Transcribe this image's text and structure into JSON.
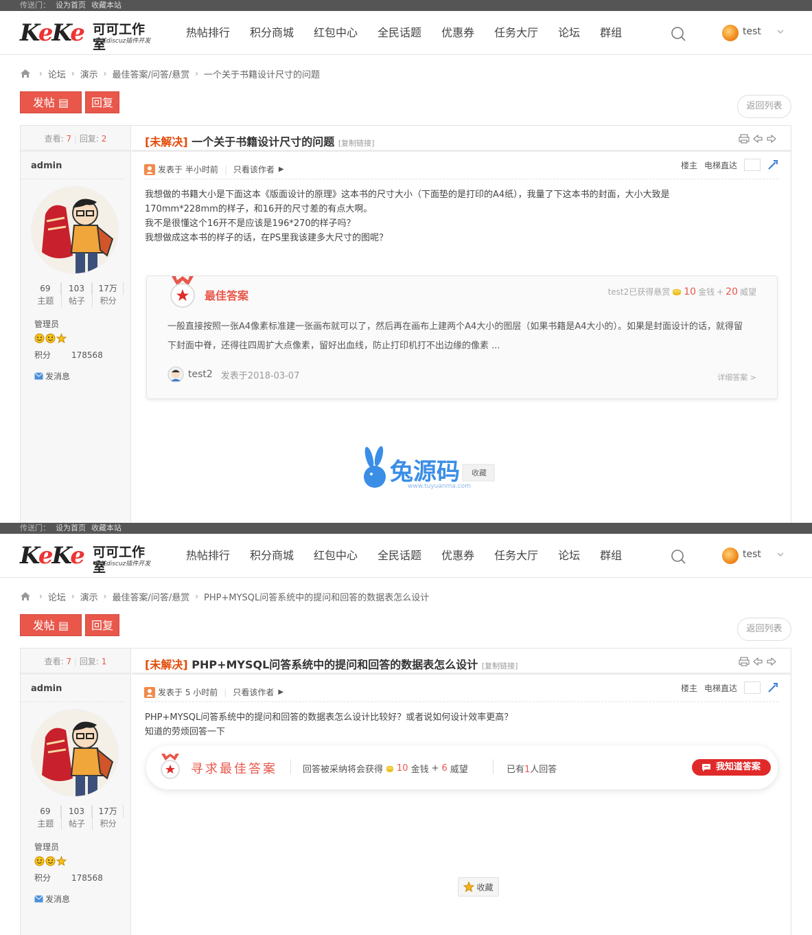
{
  "topbar": {
    "label": "传送门：",
    "set_home": "设为首页",
    "bookmark": "收藏本站"
  },
  "logo": {
    "mark_k1": "K",
    "mark_e": "e",
    "mark_k2": "K",
    "mark_o": "e",
    "cn": "可可工作室",
    "sub": "专注discuz插件开发"
  },
  "nav": [
    "热帖排行",
    "积分商城",
    "红包中心",
    "全民话题",
    "优惠券",
    "任务大厅",
    "论坛",
    "群组"
  ],
  "user": {
    "name": "test"
  },
  "post_button": "发帖",
  "reply_button": "回复",
  "back_button": "返回列表",
  "side": {
    "view_label": "查看:",
    "reply_label": "回复:",
    "author": "admin",
    "threads": "69",
    "threads_label": "主题",
    "posts": "103",
    "posts_label": "帖子",
    "credits": "17万",
    "credits_label": "积分",
    "group": "管理员",
    "score_label": "积分",
    "score_value": "178568",
    "message": "发消息"
  },
  "status": "未解决",
  "copy_link": "[复制链接]",
  "meta": {
    "posted_prefix": "发表于",
    "only_author": "只看该作者",
    "floor": "楼主",
    "elevator": "电梯直达"
  },
  "shot1": {
    "views": "7",
    "replies": "2",
    "crumbs": [
      "论坛",
      "演示",
      "最佳答案/问答/悬赏",
      "一个关于书籍设计尺寸的问题"
    ],
    "title": "一个关于书籍设计尺寸的问题",
    "posted": "半小时前",
    "content": [
      "我想做的书籍大小是下面这本《版面设计的原理》这本书的尺寸大小（下面垫的是打印的A4纸），我量了下这本书的封面，大小大致是",
      "170mm*228mm的样子，和16开的尺寸差的有点大啊。",
      "我不是很懂这个16开不是应该是196*270的样子吗？",
      "我想做成这本书的样子的话，在PS里我该建多大尺寸的图呢？"
    ],
    "best": {
      "title": "最佳答案",
      "reward_prefix": "test2已获得悬赏",
      "coins": "10",
      "coins_label": "金钱",
      "plus": "+",
      "prestige": "20",
      "prestige_label": "威望",
      "text": "一般直接按照一张A4像素标准建一张画布就可以了，然后再在画布上建两个A4大小的图层（如果书籍是A4大小的）。如果是封面设计的话，就得留下封面中脊，还得往四周扩大点像素，留好出血线，防止打印机打不出边缘的像素 ...",
      "user": "test2",
      "time": "发表于2018-03-07",
      "more": "详细答案 >"
    },
    "watermark": {
      "cn": "兔源码",
      "url": "www.tuyuanma.com",
      "fav": "收藏"
    }
  },
  "shot2": {
    "views": "7",
    "replies": "1",
    "crumbs": [
      "论坛",
      "演示",
      "最佳答案/问答/悬赏",
      "PHP+MYSQL问答系统中的提问和回答的数据表怎么设计"
    ],
    "title": "PHP+MYSQL问答系统中的提问和回答的数据表怎么设计",
    "posted": "5 小时前",
    "content": [
      "PHP+MYSQL问答系统中的提问和回答的数据表怎么设计比较好？或者说如何设计效率更高？",
      "知道的劳烦回答一下"
    ],
    "seek": {
      "title": "寻求最佳答案",
      "info_prefix": "回答被采纳将会获得",
      "coins": "10",
      "coins_label": "金钱",
      "plus": "+",
      "prestige": "6",
      "prestige_label": "威望",
      "count_prefix": "已有",
      "count": "1",
      "count_suffix": "人回答",
      "button": "我知道答案"
    },
    "fav": "收藏"
  },
  "colors": {
    "accent": "#e8574a",
    "status": "#e24c0a",
    "topbar": "#555555",
    "button_red": "#e02a2a"
  }
}
